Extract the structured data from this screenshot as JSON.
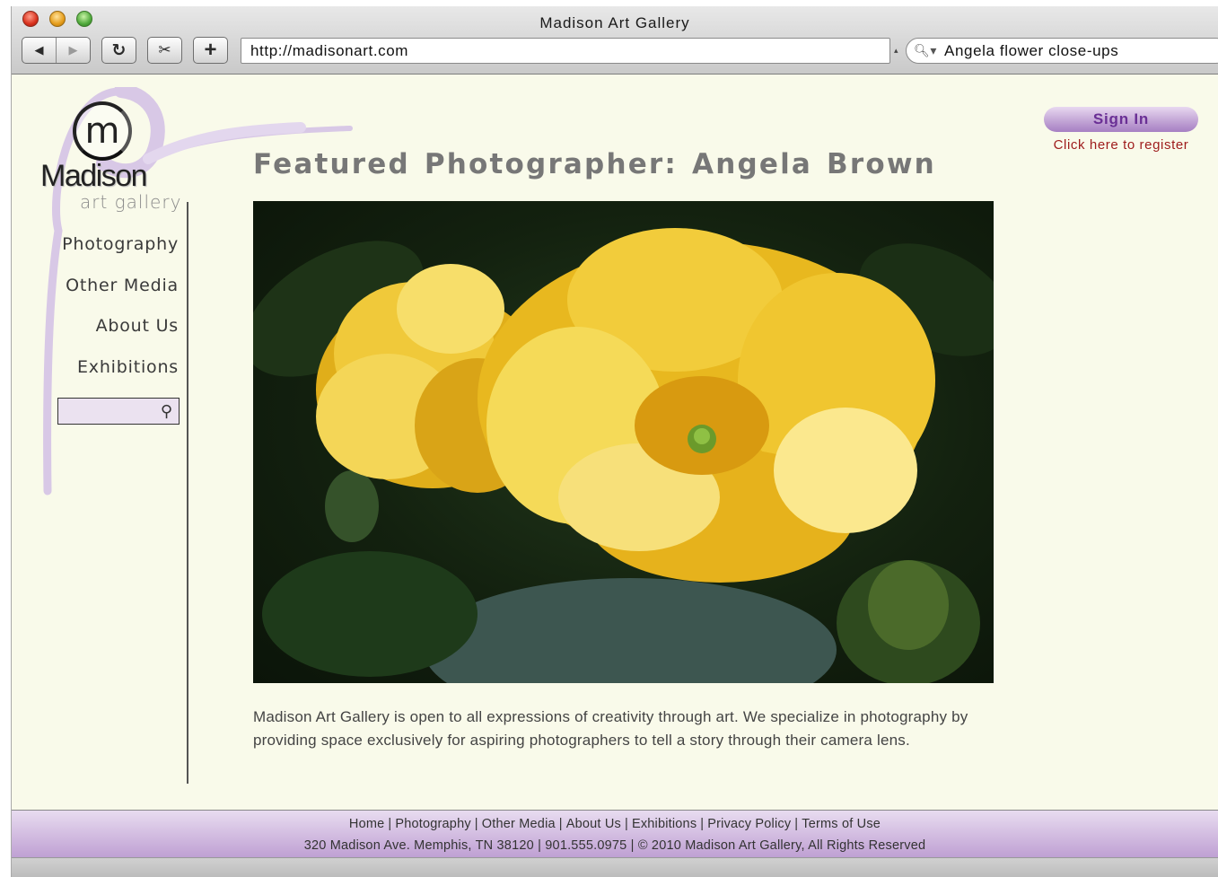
{
  "browser": {
    "title": "Madison Art Gallery",
    "address": "http://madisonart.com",
    "search_value": "Angela flower close-ups"
  },
  "logo": {
    "letter": "m",
    "name": "Madison",
    "subtitle": "art gallery"
  },
  "sidebar": {
    "items": [
      {
        "label": "Photography"
      },
      {
        "label": "Other Media"
      },
      {
        "label": "About Us"
      },
      {
        "label": "Exhibitions"
      }
    ],
    "search_value": ""
  },
  "account": {
    "sign_in": "Sign In",
    "register": "Click here to register"
  },
  "main": {
    "headline": "Featured Photographer: Angela Brown",
    "intro": "Madison Art Gallery is open to all expressions of creativity through art. We specialize in photography by providing space exclusively for aspiring photographers to tell a story through their camera lens."
  },
  "footer": {
    "links": [
      "Home",
      "Photography",
      "Other Media",
      "About Us",
      "Exhibitions",
      "Privacy Policy",
      "Terms of Use"
    ],
    "address": "320 Madison Ave. Memphis, TN 38120 | 901.555.0975 | © 2010 Madison Art Gallery, All Rights Reserved"
  },
  "colors": {
    "page_bg": "#f9faea",
    "accent_purple": "#c3a6d6",
    "sign_in_text": "#6a2f95",
    "register_text": "#9e1b1b",
    "headline_text": "#777777"
  },
  "icons": {
    "close": "close-window-icon",
    "minimize": "minimize-window-icon",
    "maximize": "maximize-window-icon",
    "back": "back-arrow-icon",
    "forward": "forward-arrow-icon",
    "reload": "reload-icon",
    "snip": "web-clip-icon",
    "add": "add-bookmark-icon",
    "search": "search-icon"
  }
}
